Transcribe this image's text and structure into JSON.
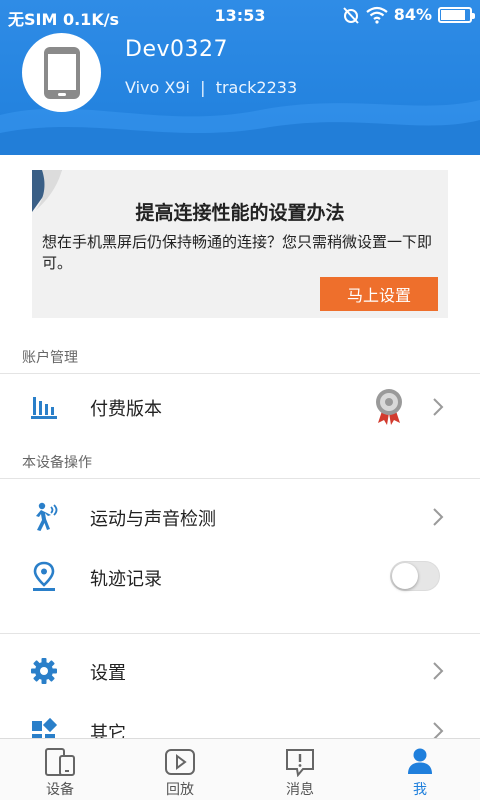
{
  "status_bar": {
    "carrier": "无SIM 0.1K/s",
    "time": "13:53",
    "battery": "84%",
    "battery_level": 0.84
  },
  "profile": {
    "device_name": "Dev0327",
    "device_subtitle": "Vivo X9i  |  track2233"
  },
  "promo": {
    "title": "提高连接性能的设置办法",
    "description": "想在手机黑屏后仍保持畅通的连接？您只需稍微设置一下即可。",
    "button": "马上设置"
  },
  "account_section": {
    "label": "账户管理",
    "items": [
      {
        "label": "付费版本",
        "icon": "chart-bars-icon"
      }
    ]
  },
  "device_section": {
    "label": "本设备操作",
    "items": [
      {
        "label": "运动与声音检测",
        "icon": "walking-person-icon"
      },
      {
        "label": "轨迹记录",
        "icon": "location-pin-icon",
        "toggle": false
      }
    ]
  },
  "other_section": {
    "items": [
      {
        "label": "设置",
        "icon": "gear-icon"
      },
      {
        "label": "其它",
        "icon": "apps-icon"
      }
    ]
  },
  "bottom_nav": [
    {
      "label": "设备",
      "icon": "device-icon",
      "active": false
    },
    {
      "label": "回放",
      "icon": "play-icon",
      "active": false
    },
    {
      "label": "消息",
      "icon": "message-icon",
      "active": false
    },
    {
      "label": "我",
      "icon": "user-icon",
      "active": true
    }
  ],
  "colors": {
    "primary": "#1f7fdc",
    "accent": "#ee6f2c",
    "icon_blue": "#2a7fc9"
  }
}
